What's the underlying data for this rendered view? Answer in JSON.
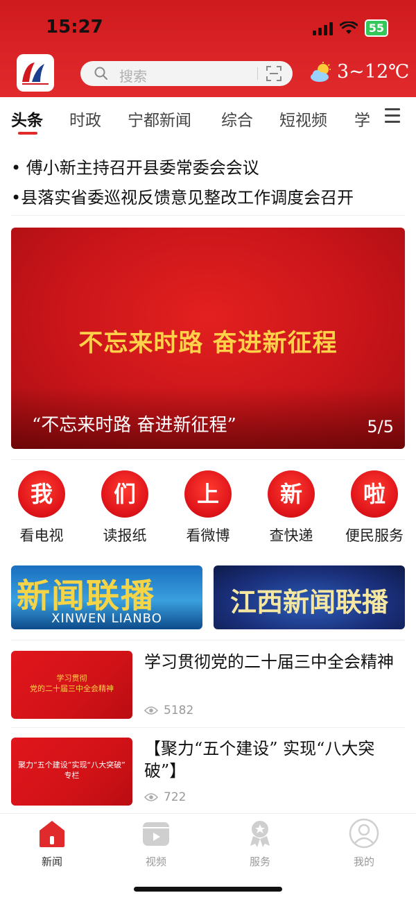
{
  "status_bar": {
    "time": "15:27",
    "battery": "55"
  },
  "header": {
    "search_placeholder": "搜索",
    "weather": "3~12℃",
    "colors": {
      "brand_red": "#e12a2c",
      "accent_gold": "#ffd24a"
    }
  },
  "tabs": [
    "头条",
    "时政",
    "宁都新闻",
    "综合",
    "短视频",
    "学"
  ],
  "ticker": [
    "• 傅小新主持召开县委常委会会议",
    "•县落实省委巡视反馈意见整改工作调度会召开"
  ],
  "banner": {
    "slogan": "不忘来时路 奋进新征程",
    "caption": "“不忘来时路  奋进新征程”",
    "index": "5/5"
  },
  "quick_links": [
    {
      "char": "我",
      "label": "看电视"
    },
    {
      "char": "们",
      "label": "读报纸"
    },
    {
      "char": "上",
      "label": "看微博"
    },
    {
      "char": "新",
      "label": "查快递"
    },
    {
      "char": "啦",
      "label": "便民服务"
    }
  ],
  "news_banners": {
    "left_title": "新闻联播",
    "left_sub": "XINWEN LIANBO",
    "right_title": "江西新闻联播"
  },
  "articles": [
    {
      "thumb_text": "学习贯彻\n党的二十届三中全会精神",
      "title": "学习贯彻党的二十届三中全会精神",
      "views": "5182"
    },
    {
      "thumb_text": "聚力“五个建设”实现“八大突破”\n专栏",
      "title": "【聚力“五个建设” 实现“八大突破”】",
      "views": "722"
    }
  ],
  "bottom_nav": [
    {
      "label": "新闻",
      "icon": "home-icon",
      "active": true
    },
    {
      "label": "视频",
      "icon": "video-icon",
      "active": false
    },
    {
      "label": "服务",
      "icon": "service-icon",
      "active": false
    },
    {
      "label": "我的",
      "icon": "user-icon",
      "active": false
    }
  ]
}
